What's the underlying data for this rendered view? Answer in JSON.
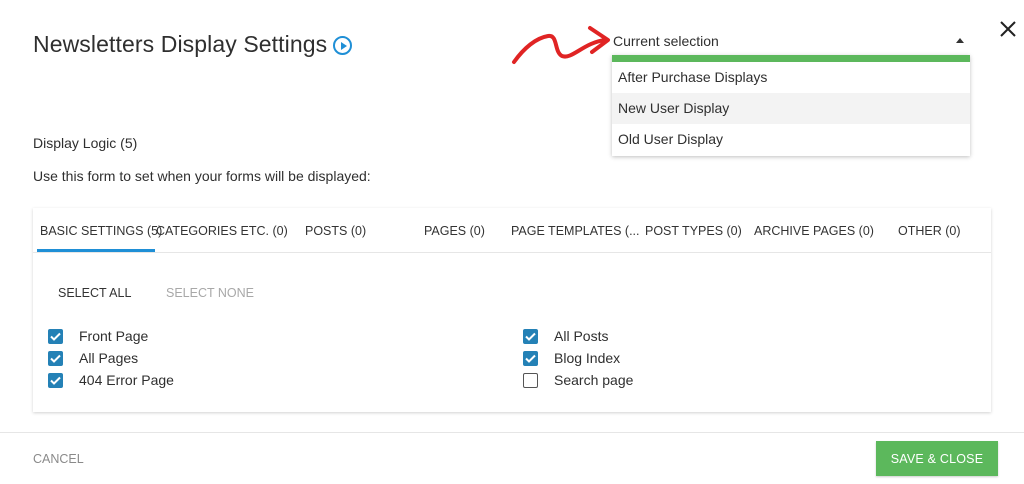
{
  "dialog": {
    "title": "Newsletters Display Settings",
    "play_icon": "play-circle-icon",
    "close_icon": "close-icon"
  },
  "selector": {
    "current_label": "Current selection",
    "options": [
      {
        "label": "After Purchase Displays",
        "highlighted": false
      },
      {
        "label": "New User Display",
        "highlighted": true
      },
      {
        "label": "Old User Display",
        "highlighted": false
      }
    ],
    "accent_color": "#5cb85c"
  },
  "display_logic": {
    "title": "Display Logic (5)",
    "description": "Use this form to set when your forms will be displayed:"
  },
  "tabs": [
    {
      "label": "BASIC SETTINGS (5)",
      "active": true
    },
    {
      "label": "CATEGORIES ETC. (0)",
      "active": false
    },
    {
      "label": "POSTS (0)",
      "active": false
    },
    {
      "label": "PAGES (0)",
      "active": false
    },
    {
      "label": "PAGE TEMPLATES (...",
      "active": false
    },
    {
      "label": "POST TYPES (0)",
      "active": false
    },
    {
      "label": "ARCHIVE PAGES (0)",
      "active": false
    },
    {
      "label": "OTHER (0)",
      "active": false
    }
  ],
  "actions": {
    "select_all": "SELECT ALL",
    "select_none": "SELECT NONE"
  },
  "checkboxes_left": [
    {
      "label": "Front Page",
      "checked": true
    },
    {
      "label": "All Pages",
      "checked": true
    },
    {
      "label": "404 Error Page",
      "checked": true
    }
  ],
  "checkboxes_right": [
    {
      "label": "All Posts",
      "checked": true
    },
    {
      "label": "Blog Index",
      "checked": true
    },
    {
      "label": "Search page",
      "checked": false
    }
  ],
  "footer": {
    "cancel": "CANCEL",
    "save": "SAVE & CLOSE"
  },
  "colors": {
    "accent_blue": "#1f8fd6",
    "checkbox_blue": "#2481b6",
    "save_green": "#5cb85c",
    "annotation_red": "#e02424"
  }
}
